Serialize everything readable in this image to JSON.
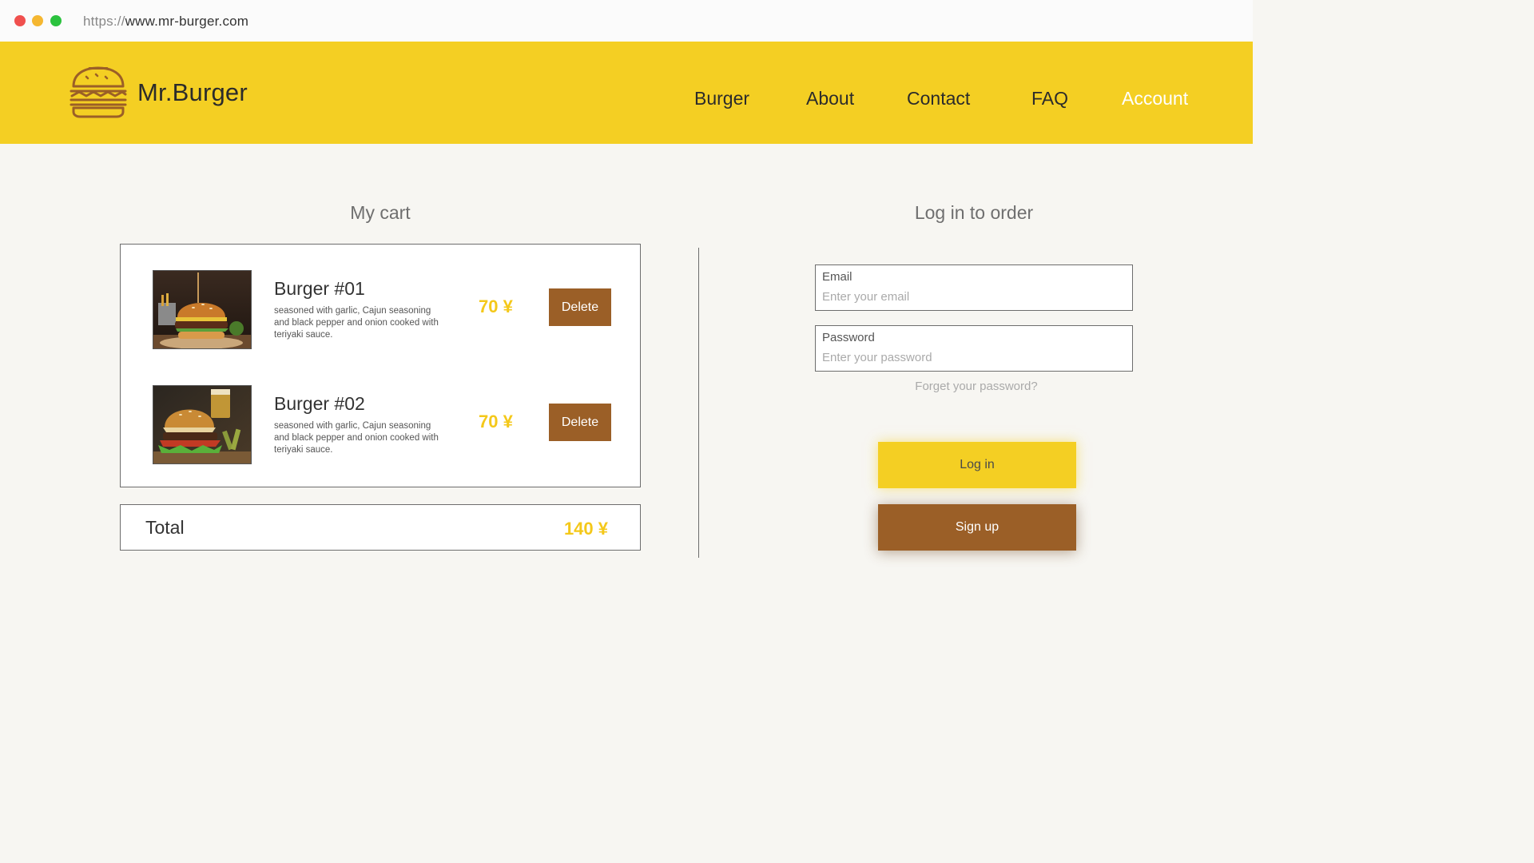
{
  "browser": {
    "url_protocol": "https://",
    "url_host": "www.mr-burger.com"
  },
  "header": {
    "brand": "Mr.Burger",
    "logo_icon": "burger-icon",
    "nav": {
      "burger": "Burger",
      "about": "About",
      "contact": "Contact",
      "faq": "FAQ",
      "account": "Account"
    },
    "active_nav": "Account"
  },
  "cart": {
    "title": "My cart",
    "items": [
      {
        "name": "Burger #01",
        "description": "seasoned with garlic, Cajun seasoning and black pepper and onion cooked with teriyaki sauce.",
        "price": "70 ¥",
        "delete_label": "Delete"
      },
      {
        "name": "Burger #02",
        "description": "seasoned with garlic, Cajun seasoning and black pepper and onion cooked with teriyaki sauce.",
        "price": "70 ¥",
        "delete_label": "Delete"
      }
    ],
    "total_label": "Total",
    "total_value": "140 ¥"
  },
  "login": {
    "title": "Log in to order",
    "email_label": "Email",
    "email_placeholder": "Enter your email",
    "password_label": "Password",
    "password_placeholder": "Enter your password",
    "forgot_label": "Forget your password?",
    "login_label": "Log in",
    "signup_label": "Sign up"
  },
  "colors": {
    "header_yellow": "#f4cf23",
    "price_yellow": "#f4c81a",
    "button_brown": "#9b5f27",
    "page_background": "#f7f6f2"
  }
}
